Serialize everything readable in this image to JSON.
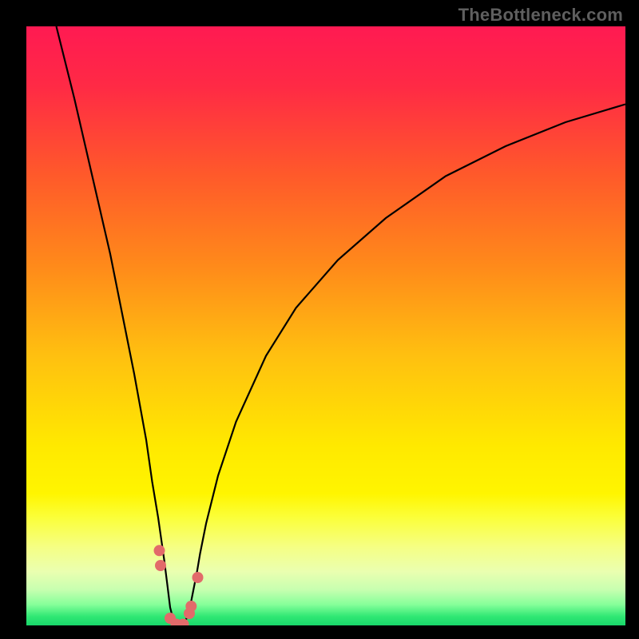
{
  "watermark": "TheBottleneck.com",
  "chart_data": {
    "type": "line",
    "title": "",
    "xlabel": "",
    "ylabel": "",
    "xlim": [
      0,
      100
    ],
    "ylim": [
      0,
      100
    ],
    "x": [
      5,
      8,
      11,
      14,
      16,
      18,
      20,
      21,
      22,
      23,
      23.5,
      24,
      24.5,
      25,
      25.2,
      26,
      26.5,
      27,
      27.5,
      28.5,
      29,
      30,
      32,
      35,
      40,
      45,
      52,
      60,
      70,
      80,
      90,
      100
    ],
    "values": [
      100,
      88,
      75,
      62,
      52,
      42,
      31,
      24,
      18,
      11,
      7,
      3,
      1,
      0,
      0,
      0,
      0.5,
      2,
      4,
      9,
      12,
      17,
      25,
      34,
      45,
      53,
      61,
      68,
      75,
      80,
      84,
      87
    ],
    "marker_points_x": [
      22.2,
      22.4,
      24.0,
      25.0,
      26.2,
      27.2,
      27.5,
      28.6
    ],
    "marker_points_y": [
      12.5,
      10.0,
      1.2,
      0.2,
      0.2,
      2.0,
      3.2,
      8.0
    ],
    "gradient_stops": [
      {
        "offset": 0.0,
        "color": "#ff1a52"
      },
      {
        "offset": 0.1,
        "color": "#ff2a45"
      },
      {
        "offset": 0.25,
        "color": "#ff5a2a"
      },
      {
        "offset": 0.4,
        "color": "#ff8a1a"
      },
      {
        "offset": 0.55,
        "color": "#ffc010"
      },
      {
        "offset": 0.7,
        "color": "#ffe900"
      },
      {
        "offset": 0.78,
        "color": "#fff500"
      },
      {
        "offset": 0.82,
        "color": "#fbff3a"
      },
      {
        "offset": 0.87,
        "color": "#f5ff85"
      },
      {
        "offset": 0.91,
        "color": "#eaffb0"
      },
      {
        "offset": 0.94,
        "color": "#c8ffb0"
      },
      {
        "offset": 0.965,
        "color": "#86ff9a"
      },
      {
        "offset": 0.985,
        "color": "#30e874"
      },
      {
        "offset": 1.0,
        "color": "#18d66a"
      }
    ],
    "marker_color": "#e26a6a",
    "curve_color": "#000000"
  }
}
